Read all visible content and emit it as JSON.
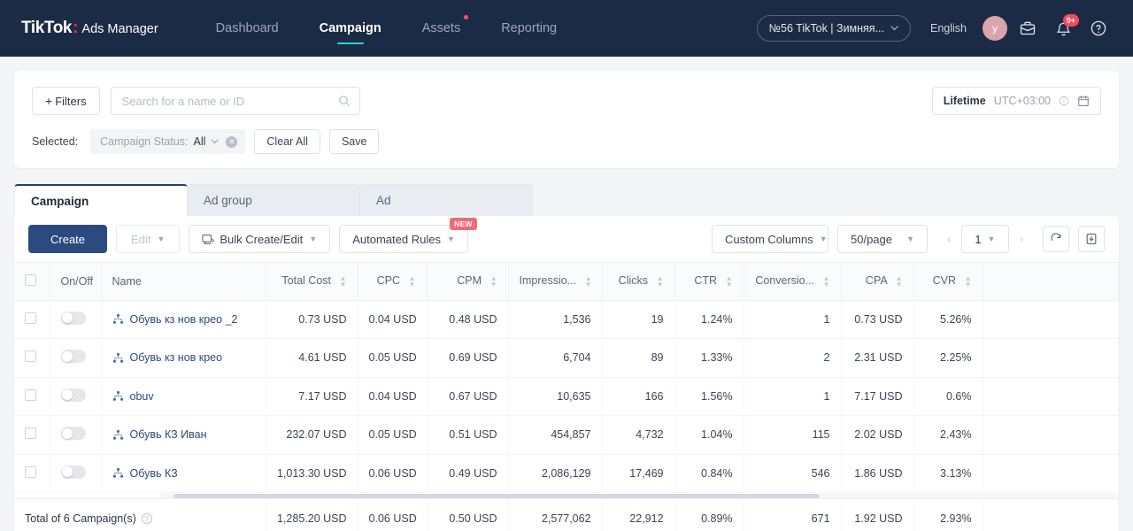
{
  "nav": {
    "brand_name": "TikTok",
    "brand_colon": ":",
    "brand_sub": "Ads Manager",
    "items": [
      {
        "label": "Dashboard",
        "active": false,
        "dot": false
      },
      {
        "label": "Campaign",
        "active": true,
        "dot": false
      },
      {
        "label": "Assets",
        "active": false,
        "dot": true
      },
      {
        "label": "Reporting",
        "active": false,
        "dot": false
      }
    ],
    "account": "№56 TikTok | Зимняя...",
    "language": "English",
    "avatar_initial": "y",
    "notification_badge": "9+"
  },
  "filters": {
    "filters_button": "Filters",
    "plus": "+",
    "search_placeholder": "Search for a name or ID",
    "search_value": "",
    "selected_label": "Selected:",
    "chip_key": "Campaign Status:",
    "chip_value": "All",
    "clear_all": "Clear All",
    "save": "Save",
    "date_range": "Lifetime",
    "timezone": "UTC+03:00"
  },
  "tabs": [
    {
      "label": "Campaign",
      "active": true
    },
    {
      "label": "Ad group",
      "active": false
    },
    {
      "label": "Ad",
      "active": false
    }
  ],
  "toolbar": {
    "create": "Create",
    "edit": "Edit",
    "bulk": "Bulk Create/Edit",
    "automated_rules": "Automated Rules",
    "new_badge": "NEW",
    "custom_columns": "Custom Columns",
    "page_size": "50/page",
    "page_number": "1",
    "prev": "‹",
    "next": "›"
  },
  "table": {
    "columns": [
      {
        "label": "On/Off",
        "align": "l",
        "sortable": false
      },
      {
        "label": "Name",
        "align": "l",
        "sortable": false
      },
      {
        "label": "Total Cost",
        "align": "r",
        "sortable": true
      },
      {
        "label": "CPC",
        "align": "r",
        "sortable": true
      },
      {
        "label": "CPM",
        "align": "r",
        "sortable": true
      },
      {
        "label": "Impressio...",
        "align": "r",
        "sortable": true
      },
      {
        "label": "Clicks",
        "align": "r",
        "sortable": true
      },
      {
        "label": "CTR",
        "align": "r",
        "sortable": true
      },
      {
        "label": "Conversio...",
        "align": "r",
        "sortable": true
      },
      {
        "label": "CPA",
        "align": "r",
        "sortable": true
      },
      {
        "label": "CVR",
        "align": "r",
        "sortable": true
      }
    ],
    "rows": [
      {
        "name": "Обувь кз нов крео _2",
        "enabled": false,
        "total_cost": "0.73 USD",
        "cpc": "0.04 USD",
        "cpm": "0.48 USD",
        "impressions": "1,536",
        "clicks": "19",
        "ctr": "1.24%",
        "conversions": "1",
        "cpa": "0.73 USD",
        "cvr": "5.26%"
      },
      {
        "name": "Обувь кз нов крео",
        "enabled": false,
        "total_cost": "4.61 USD",
        "cpc": "0.05 USD",
        "cpm": "0.69 USD",
        "impressions": "6,704",
        "clicks": "89",
        "ctr": "1.33%",
        "conversions": "2",
        "cpa": "2.31 USD",
        "cvr": "2.25%"
      },
      {
        "name": "obuv",
        "enabled": false,
        "total_cost": "7.17 USD",
        "cpc": "0.04 USD",
        "cpm": "0.67 USD",
        "impressions": "10,635",
        "clicks": "166",
        "ctr": "1.56%",
        "conversions": "1",
        "cpa": "7.17 USD",
        "cvr": "0.6%"
      },
      {
        "name": "Обувь КЗ Иван",
        "enabled": false,
        "total_cost": "232.07 USD",
        "cpc": "0.05 USD",
        "cpm": "0.51 USD",
        "impressions": "454,857",
        "clicks": "4,732",
        "ctr": "1.04%",
        "conversions": "115",
        "cpa": "2.02 USD",
        "cvr": "2.43%"
      },
      {
        "name": "Обувь КЗ",
        "enabled": false,
        "total_cost": "1,013.30 USD",
        "cpc": "0.06 USD",
        "cpm": "0.49 USD",
        "impressions": "2,086,129",
        "clicks": "17,469",
        "ctr": "0.84%",
        "conversions": "546",
        "cpa": "1.86 USD",
        "cvr": "3.13%"
      }
    ],
    "total": {
      "label": "Total of 6 Campaign(s)",
      "total_cost": "1,285.20 USD",
      "cpc": "0.06 USD",
      "cpm": "0.50 USD",
      "impressions": "2,577,062",
      "clicks": "22,912",
      "ctr": "0.89%",
      "conversions": "671",
      "cpa": "1.92 USD",
      "cvr": "2.93%"
    }
  },
  "colors": {
    "nav_bg": "#1c2b45",
    "accent_teal": "#25d6d6",
    "primary_blue": "#2a4a80",
    "brand_red": "#ff2e4d",
    "badge_red": "#f5485f",
    "new_badge": "#f26a72"
  }
}
